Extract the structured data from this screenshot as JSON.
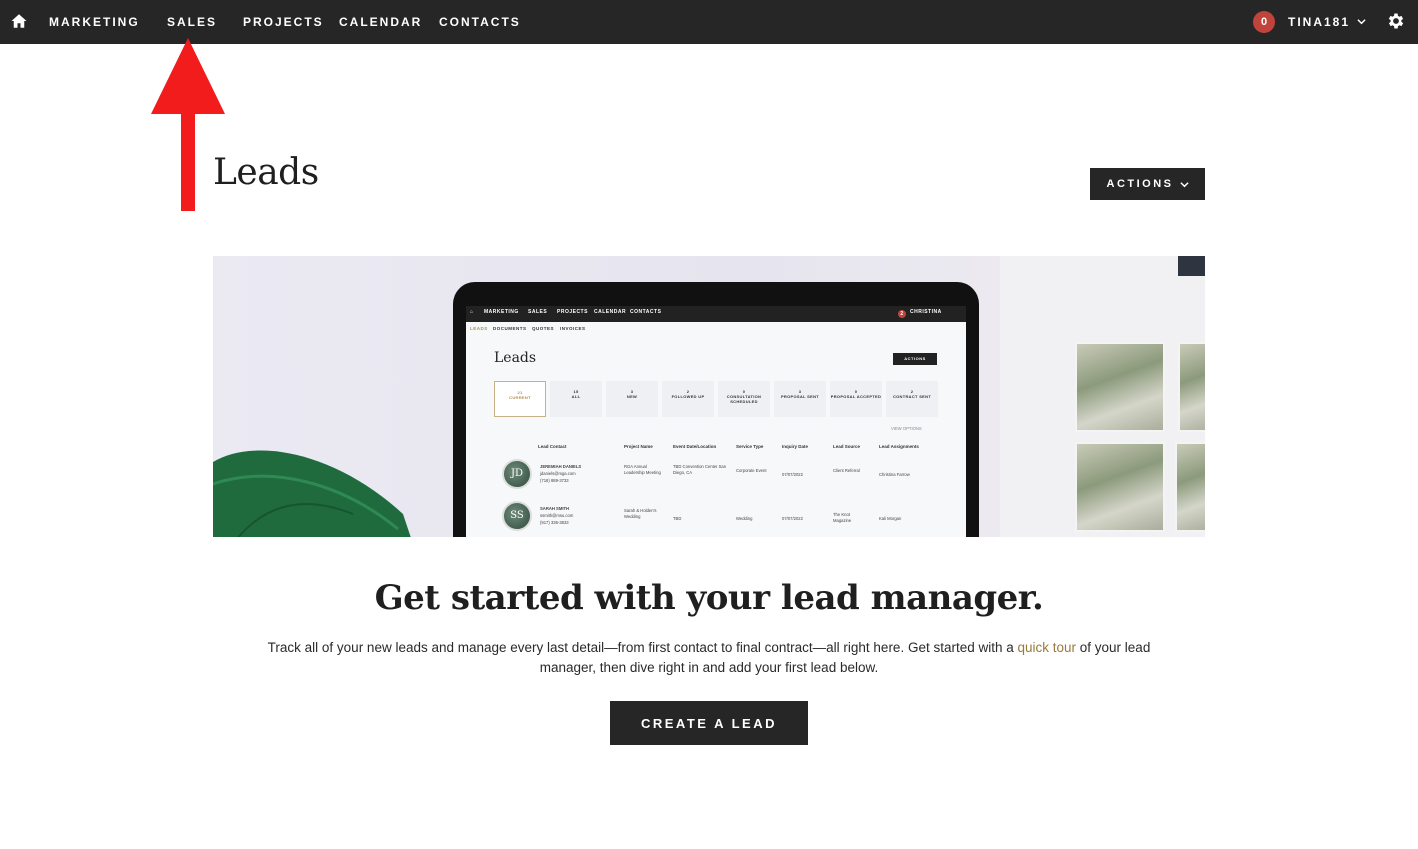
{
  "nav": {
    "items": [
      {
        "label": "MARKETING"
      },
      {
        "label": "SALES"
      },
      {
        "label": "PROJECTS"
      },
      {
        "label": "CALENDAR"
      },
      {
        "label": "CONTACTS"
      }
    ],
    "notification_count": "0",
    "username": "TINA181"
  },
  "page": {
    "title": "Leads",
    "actions_label": "ACTIONS"
  },
  "hero": {
    "screen": {
      "nav": [
        "MARKETING",
        "SALES",
        "PROJECTS",
        "CALENDAR",
        "CONTACTS"
      ],
      "user": "CHRISTINA",
      "badge": "2",
      "subnav": [
        "LEADS",
        "DOCUMENTS",
        "QUOTES",
        "INVOICES"
      ],
      "title": "Leads",
      "actions": "ACTIONS",
      "cards": [
        {
          "count": "21",
          "label": "CURRENT"
        },
        {
          "count": "15",
          "label": "ALL"
        },
        {
          "count": "3",
          "label": "NEW"
        },
        {
          "count": "2",
          "label": "FOLLOWED UP"
        },
        {
          "count": "0",
          "label": "CONSULTATION SCHEDULED"
        },
        {
          "count": "3",
          "label": "PROPOSAL SENT"
        },
        {
          "count": "0",
          "label": "PROPOSAL ACCEPTED"
        },
        {
          "count": "2",
          "label": "CONTRACT SENT"
        }
      ],
      "view_options": "VIEW OPTIONS",
      "columns": [
        "Lead Contact",
        "Project Name",
        "Event Date/Location",
        "Service Type",
        "Inquiry Date",
        "Lead Source",
        "Lead Assignments"
      ],
      "rows": [
        {
          "initials": "JD",
          "name": "JEREMIAH DANIELS",
          "email": "jdaniels@mga.com",
          "phone": "(718) 889-3733",
          "project": "RGA Annual Leadership Meeting",
          "event": "TBD Convention Center San Diego, CA",
          "service": "Corporate Event",
          "date": "07/07/2022",
          "source": "Client Referral",
          "assign": "Christina Farrow"
        },
        {
          "initials": "SS",
          "name": "SARAH SMITH",
          "email": "ssmith@msu.com",
          "phone": "(917) 336-3833",
          "project": "Sarah & Holden's Wedding",
          "event": "TBD",
          "service": "Wedding",
          "date": "07/07/2022",
          "source": "The Knot Magazine",
          "assign": "Kali Morgan"
        }
      ]
    }
  },
  "content": {
    "headline": "Get started with your lead manager.",
    "desc_part1": "Track all of your new leads and manage every last detail—from first contact to final contract—all right here. Get started with a ",
    "desc_link": "quick tour",
    "desc_part2": " of your lead manager, then dive right in and add your first lead below.",
    "cta_label": "CREATE A LEAD"
  },
  "colors": {
    "nav_bg": "#262626",
    "badge": "#c0443c",
    "link": "#9a7a3d",
    "annotation_arrow": "#f21c1c"
  }
}
